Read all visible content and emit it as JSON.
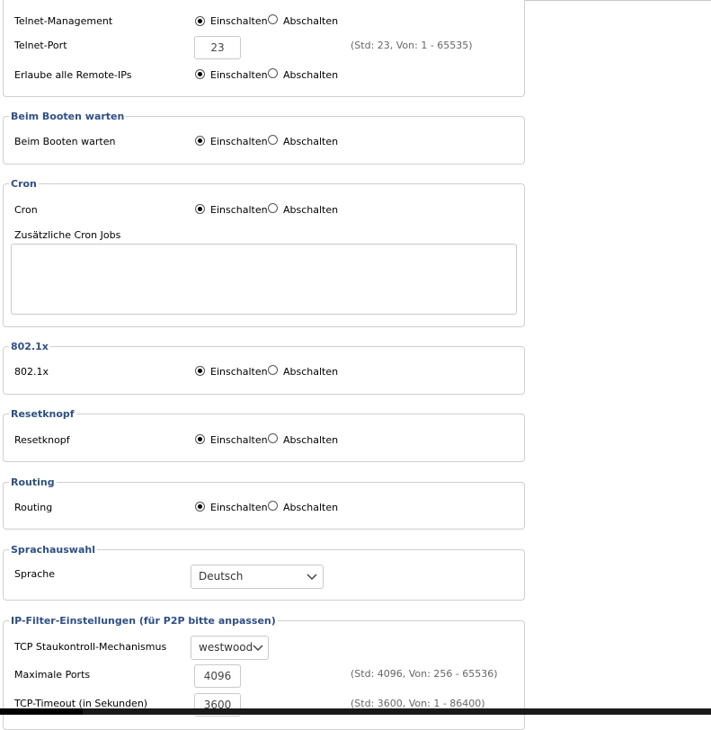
{
  "options": {
    "on": "Einschalten",
    "off": "Abschalten"
  },
  "telnet": {
    "management_label": "Telnet-Management",
    "port_label": "Telnet-Port",
    "port_value": "23",
    "port_hint": "(Std: 23, Von: 1 - 65535)",
    "remote_label": "Erlaube alle Remote-IPs"
  },
  "boot": {
    "legend": "Beim Booten warten",
    "label": "Beim Booten warten"
  },
  "cron": {
    "legend": "Cron",
    "label": "Cron",
    "jobs_label": "Zusätzliche Cron Jobs",
    "jobs_value": ""
  },
  "dot1x": {
    "legend": "802.1x",
    "label": "802.1x"
  },
  "reset": {
    "legend": "Resetknopf",
    "label": "Resetknopf"
  },
  "routing": {
    "legend": "Routing",
    "label": "Routing"
  },
  "language": {
    "legend": "Sprachauswahl",
    "label": "Sprache",
    "value": "Deutsch"
  },
  "ipfilter": {
    "legend": "IP-Filter-Einstellungen (für P2P bitte anpassen)",
    "tcp_label": "TCP Staukontroll-Mechanismus",
    "tcp_value": "westwood",
    "ports_label": "Maximale Ports",
    "ports_value": "4096",
    "ports_hint": "(Std: 4096, Von: 256 - 65536)",
    "timeout_label": "TCP-Timeout (in Sekunden)",
    "timeout_value": "3600",
    "timeout_hint": "(Std: 3600, Von: 1 - 86400)"
  }
}
